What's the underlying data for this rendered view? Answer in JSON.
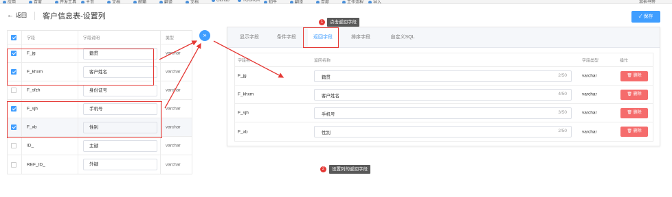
{
  "bookmarks": [
    "应用",
    "百度",
    "开发工具",
    "主页",
    "文档",
    "邮箱",
    "翻译",
    "文档",
    "GitHub",
    "YOUKOK",
    "知乎",
    "翻译",
    "百度",
    "工作流程",
    "导入"
  ],
  "bookmark_right": "其他书签",
  "header": {
    "back_label": "返回",
    "back_arrow": "←",
    "title": "客户信息表-设置列",
    "save_label": "✓ 保存"
  },
  "left_table": {
    "headers": {
      "field": "字段",
      "desc": "字段说明",
      "type": "类型"
    },
    "rows": [
      {
        "checked": true,
        "field": "F_jg",
        "desc": "籍贯",
        "type": "varchar"
      },
      {
        "checked": true,
        "field": "F_khxm",
        "desc": "客户姓名",
        "type": "varchar"
      },
      {
        "checked": false,
        "field": "F_sfzh",
        "desc": "身份证号",
        "type": "varchar"
      },
      {
        "checked": true,
        "field": "F_sjh",
        "desc": "手机号",
        "type": "varchar"
      },
      {
        "checked": true,
        "field": "F_xb",
        "desc": "性别",
        "type": "varchar"
      },
      {
        "checked": false,
        "field": "ID_",
        "desc": "主键",
        "type": "varchar"
      },
      {
        "checked": false,
        "field": "REF_ID_",
        "desc": "外键",
        "type": "varchar"
      }
    ]
  },
  "transfer_button": "»",
  "tabs": [
    "显示字段",
    "条件字段",
    "返回字段",
    "排序字段",
    "自定义SQL"
  ],
  "active_tab": "返回字段",
  "right_table": {
    "headers": {
      "field": "字段名",
      "name": "返回名称",
      "type": "字段类型",
      "op": "操作"
    },
    "rows": [
      {
        "field": "F_jg",
        "name": "籍贯",
        "count": "2/50",
        "type": "varchar",
        "action": "删除"
      },
      {
        "field": "F_khxm",
        "name": "客户姓名",
        "count": "4/50",
        "type": "varchar",
        "action": "删除"
      },
      {
        "field": "F_sjh",
        "name": "手机号",
        "count": "3/50",
        "type": "varchar",
        "action": "删除"
      },
      {
        "field": "F_xb",
        "name": "性别",
        "count": "2/50",
        "type": "varchar",
        "action": "删除"
      }
    ]
  },
  "annotations": {
    "step1_num": "1",
    "step1_text": "点击返回字段",
    "step2_num": "2",
    "step2_text": "设置列的返回字段"
  },
  "colors": {
    "primary": "#409eff",
    "danger": "#f56c6c",
    "annotation_red": "#e53935"
  }
}
